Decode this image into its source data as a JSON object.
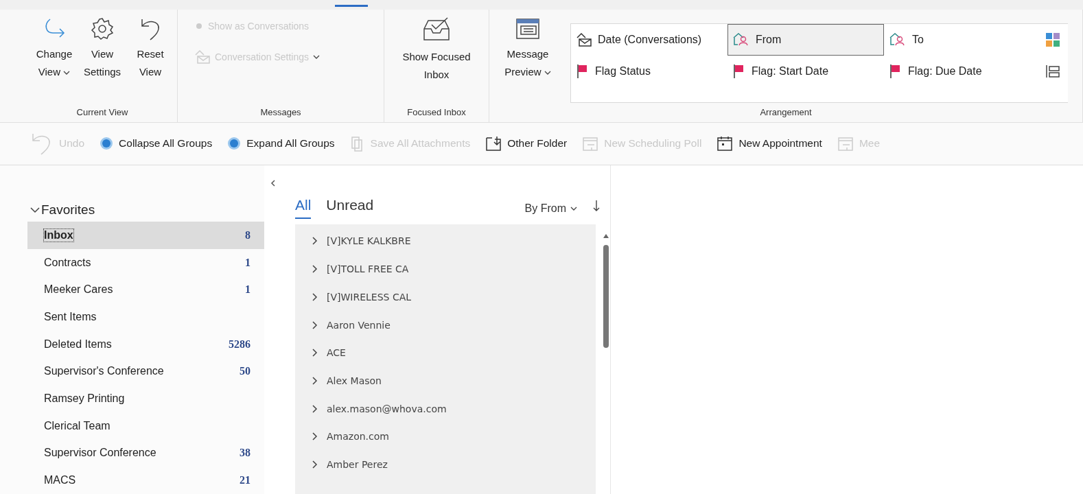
{
  "ribbon": {
    "groups": [
      {
        "label": "Current View",
        "kind": "large",
        "buttons": [
          {
            "label": "Change View",
            "kind": "arrow",
            "dropdown": true,
            "disabled": false
          },
          {
            "label": "View Settings",
            "kind": "gear",
            "dropdown": false,
            "disabled": false
          },
          {
            "label": "Reset View",
            "kind": "undo",
            "dropdown": false,
            "disabled": false
          }
        ]
      },
      {
        "label": "Messages",
        "kind": "small",
        "buttons": [
          {
            "label": "Show as Conversations",
            "kind": "dot",
            "dropdown": false,
            "disabled": true
          },
          {
            "label": "Conversation Settings",
            "kind": "envelope",
            "dropdown": true,
            "disabled": true
          }
        ]
      },
      {
        "label": "Focused Inbox",
        "kind": "large",
        "buttons": [
          {
            "label": "Show Focused Inbox",
            "kind": "inbox",
            "dropdown": false,
            "disabled": false
          }
        ]
      },
      {
        "label": "Arrangement",
        "kind": "gallery",
        "buttons": [
          {
            "label": "Message Preview",
            "kind": "preview",
            "dropdown": true,
            "disabled": false
          }
        ],
        "items": [
          {
            "label": "Date (Conversations)",
            "kind": "envelope",
            "selected": false
          },
          {
            "label": "From",
            "kind": "person",
            "selected": true
          },
          {
            "label": "To",
            "kind": "person",
            "selected": false
          },
          {
            "kind": "grid",
            "selected": false
          },
          {
            "label": "Flag Status",
            "kind": "flag",
            "selected": false
          },
          {
            "label": "Flag: Start Date",
            "kind": "flag",
            "selected": false
          },
          {
            "label": "Flag: Due Date",
            "kind": "flag",
            "selected": false
          },
          {
            "kind": "list",
            "selected": false
          }
        ]
      }
    ]
  },
  "quick_access": [
    {
      "label": "Undo",
      "kind": "undo",
      "disabled": true
    },
    {
      "label": "Collapse All Groups",
      "kind": "orb",
      "disabled": false
    },
    {
      "label": "Expand All Groups",
      "kind": "orb",
      "disabled": false
    },
    {
      "label": "Save All Attachments",
      "kind": "attach",
      "disabled": true
    },
    {
      "label": "Other Folder",
      "kind": "folder",
      "disabled": false
    },
    {
      "label": "New Scheduling Poll",
      "kind": "poll",
      "disabled": true
    },
    {
      "label": "New Appointment",
      "kind": "calendar",
      "disabled": false
    },
    {
      "label": "Mee",
      "kind": "poll",
      "disabled": true
    }
  ],
  "folders": {
    "title": "Favorites",
    "expanded": true,
    "items": [
      {
        "name": "Inbox",
        "count": "8",
        "selected": true
      },
      {
        "name": "Contracts",
        "count": "1",
        "selected": false
      },
      {
        "name": "Meeker Cares",
        "count": "1",
        "selected": false
      },
      {
        "name": "Sent Items",
        "selected": false
      },
      {
        "name": "Deleted Items",
        "count": "5286",
        "selected": false
      },
      {
        "name": "Supervisor's Conference",
        "count": "50",
        "selected": false
      },
      {
        "name": "Ramsey Printing",
        "selected": false
      },
      {
        "name": "Clerical Team",
        "selected": false
      },
      {
        "name": "Supervisor Conference",
        "count": "38",
        "selected": false
      },
      {
        "name": "MACS",
        "count": "21",
        "selected": false
      }
    ]
  },
  "mail_list": {
    "tabs": [
      {
        "label": "All",
        "selected": true
      },
      {
        "label": "Unread",
        "selected": false
      }
    ],
    "sort": "By From",
    "groups": [
      {
        "name": "[V]KYLE KALKBRE",
        "expanded": false
      },
      {
        "name": "[V]TOLL FREE CA",
        "expanded": false
      },
      {
        "name": "[V]WIRELESS CAL",
        "expanded": false
      },
      {
        "name": "Aaron Vennie",
        "expanded": false
      },
      {
        "name": "ACE",
        "expanded": false
      },
      {
        "name": "Alex Mason",
        "expanded": false
      },
      {
        "name": "alex.mason@whova.com",
        "expanded": false
      },
      {
        "name": "Amazon.com",
        "expanded": false
      },
      {
        "name": "Amber Perez",
        "expanded": false
      }
    ]
  }
}
